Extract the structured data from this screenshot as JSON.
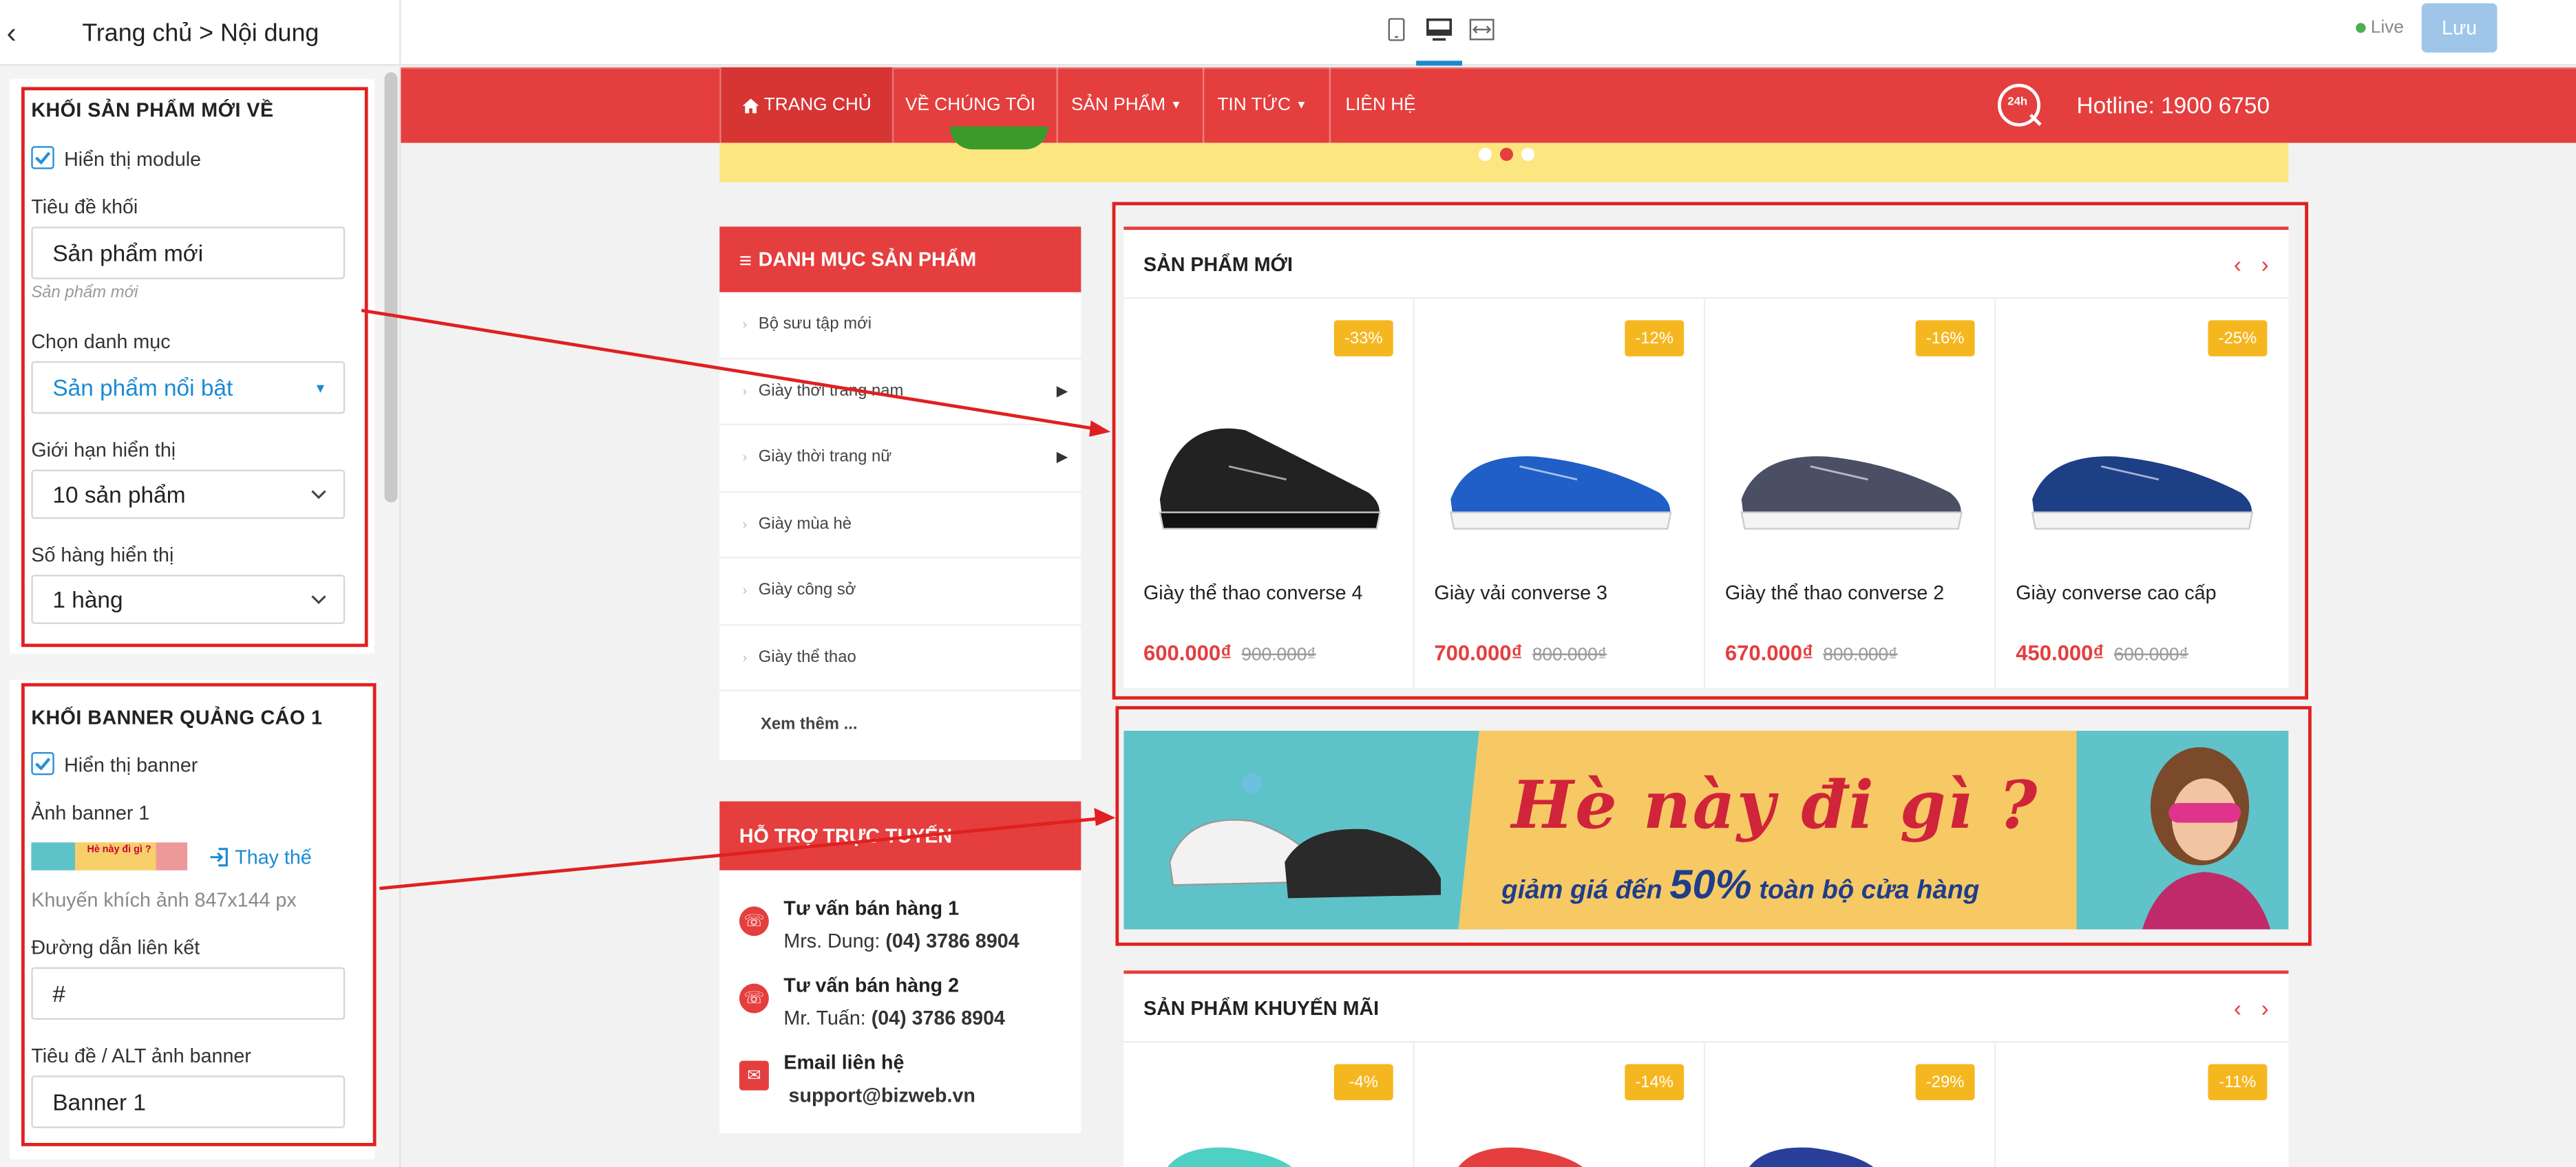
{
  "editor": {
    "breadcrumb": "Trang chủ > Nội dung",
    "live_label": "Live",
    "save_label": "Lưu"
  },
  "panel1": {
    "title": "KHỐI SẢN PHẨM MỚI VỀ",
    "show_module_label": "Hiển thị module",
    "block_title_label": "Tiêu đề khối",
    "block_title_value": "Sản phẩm mới",
    "block_title_hint": "Sản phẩm mới",
    "category_label": "Chọn danh mục",
    "category_value": "Sản phẩm nổi bật",
    "limit_label": "Giới hạn hiển thị",
    "limit_value": "10 sản phẩm",
    "rows_label": "Số hàng hiển thị",
    "rows_value": "1 hàng"
  },
  "panel2": {
    "title": "KHỐI BANNER QUẢNG CÁO 1",
    "show_banner_label": "Hiển thị banner",
    "image_label": "Ảnh banner 1",
    "replace_label": "Thay thế",
    "image_hint": "Khuyến khích ảnh 847x144 px",
    "link_label": "Đường dẫn liên kết",
    "link_value": "#",
    "alt_label": "Tiêu đề / ALT ảnh banner",
    "alt_value": "Banner 1",
    "thumb_text": "Hè này đi gì ?"
  },
  "site": {
    "nav": [
      "TRANG CHỦ",
      "VỀ CHÚNG TÔI",
      "SẢN PHẨM",
      "TIN TỨC",
      "LIÊN HỆ"
    ],
    "hotline": "Hotline: 1900 6750",
    "hotline_badge": "24h",
    "category_title": "DANH MỤC SẢN PHẨM",
    "categories": [
      "Bộ sưu tập mới",
      "Giày thời trang nam",
      "Giày thời trang nữ",
      "Giày mùa hè",
      "Giày công sở",
      "Giày thể thao",
      "Xem thêm ..."
    ],
    "support_title": "HỖ TRỢ TRỰC TUYẾN",
    "support": {
      "s1_title": "Tư vấn bán hàng 1",
      "s1_name": "Mrs. Dung: ",
      "s1_phone": "(04) 3786 8904",
      "s2_title": "Tư vấn bán hàng 2",
      "s2_name": "Mr. Tuấn: ",
      "s2_phone": "(04) 3786 8904",
      "email_title": "Email liên hệ",
      "email": "support@bizweb.vn"
    },
    "new_products_title": "SẢN PHẨM MỚI",
    "new_products": [
      {
        "badge": "-33%",
        "name": "Giày thể thao converse 4",
        "price": "600.000₫",
        "old": "900.000₫",
        "color": "#222222"
      },
      {
        "badge": "-12%",
        "name": "Giày vải converse 3",
        "price": "700.000₫",
        "old": "800.000₫",
        "color": "#1f5fc7"
      },
      {
        "badge": "-16%",
        "name": "Giày thể thao converse 2",
        "price": "670.000₫",
        "old": "800.000₫",
        "color": "#4a4f63"
      },
      {
        "badge": "-25%",
        "name": "Giày converse cao cấp",
        "price": "450.000₫",
        "old": "600.000₫",
        "color": "#1d3f86"
      }
    ],
    "banner": {
      "headline": "Hè này đi gì ?",
      "subline_pre": "giảm giá đến ",
      "subline_pct": "50%",
      "subline_post": " toàn bộ cửa hàng"
    },
    "promo_title": "SẢN PHẨM KHUYẾN MÃI",
    "promo_badges": [
      "-4%",
      "-14%",
      "-29%",
      "-11%"
    ]
  },
  "colors": {
    "brand_red": "#e53e3e",
    "accent_blue": "#1b8ad1",
    "badge": "#f5b720",
    "annotation": "#e02020"
  }
}
